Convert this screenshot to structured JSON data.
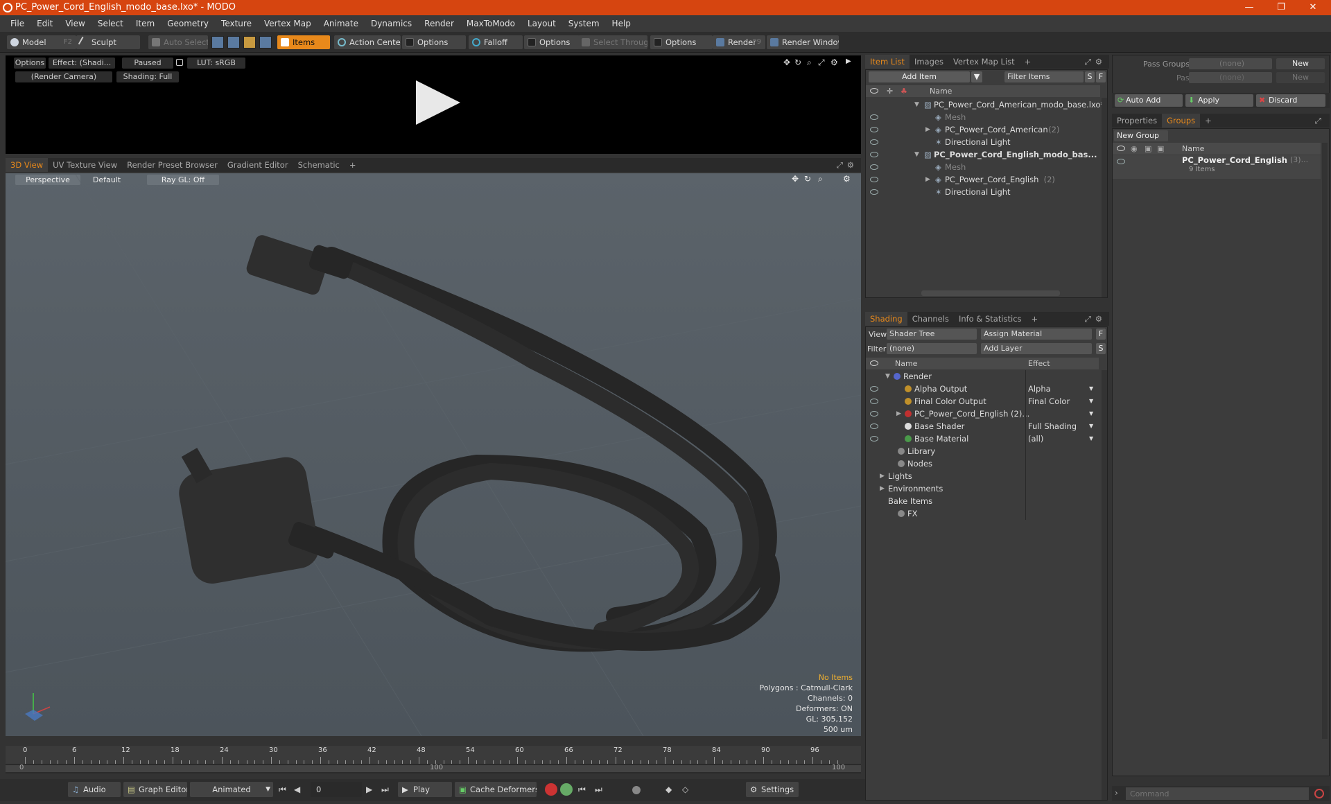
{
  "window": {
    "title": "PC_Power_Cord_English_modo_base.lxo* - MODO",
    "minimize": "—",
    "restore": "❐",
    "close": "✕"
  },
  "menu": [
    "File",
    "Edit",
    "View",
    "Select",
    "Item",
    "Geometry",
    "Texture",
    "Vertex Map",
    "Animate",
    "Dynamics",
    "Render",
    "MaxToModo",
    "Layout",
    "System",
    "Help"
  ],
  "toolbar": {
    "model": "Model",
    "model_key": "F2",
    "sculpt": "Sculpt",
    "auto_select": "Auto Select",
    "items": "Items",
    "action_center": "Action Center",
    "options1": "Options",
    "falloff": "Falloff",
    "options2": "Options",
    "select_through": "Select Through",
    "options3": "Options",
    "render": "Render",
    "render_key": "F9",
    "render_window": "Render Window"
  },
  "preview": {
    "options": "Options",
    "effect": "Effect: (Shadi...",
    "paused": "Paused",
    "lut": "LUT: sRGB",
    "camera": "(Render Camera)",
    "shading": "Shading: Full"
  },
  "viewport_tabs": [
    "3D View",
    "UV Texture View",
    "Render Preset Browser",
    "Gradient Editor",
    "Schematic",
    "+"
  ],
  "viewport": {
    "perspective": "Perspective",
    "default": "Default",
    "raygl": "Ray GL: Off"
  },
  "stats": {
    "no_items": "No Items",
    "polygons": "Polygons : Catmull-Clark",
    "channels": "Channels: 0",
    "deformers": "Deformers: ON",
    "gl": "GL: 305,152",
    "scale": "500 um"
  },
  "timeline": {
    "ticks": [
      "0",
      "6",
      "12",
      "18",
      "24",
      "30",
      "36",
      "42",
      "48",
      "54",
      "60",
      "66",
      "72",
      "78",
      "84",
      "90",
      "96"
    ],
    "range_start": "0",
    "range_mid": "100",
    "range_end": "100"
  },
  "bottom": {
    "audio": "Audio",
    "graph_editor": "Graph Editor",
    "animated": "Animated",
    "frame": "0",
    "play": "Play",
    "cache_deformers": "Cache Deformers",
    "settings": "Settings"
  },
  "item_list": {
    "tabs": [
      "Item List",
      "Images",
      "Vertex Map List",
      "+"
    ],
    "add_item": "Add Item",
    "filter_items": "Filter Items",
    "s": "S",
    "f": "F",
    "col_name": "Name",
    "rows": [
      {
        "label": "PC_Power_Cord_American_modo_base.lxo*",
        "count": ""
      },
      {
        "label": "Mesh",
        "count": ""
      },
      {
        "label": "PC_Power_Cord_American",
        "count": "(2)"
      },
      {
        "label": "Directional Light",
        "count": ""
      },
      {
        "label": "PC_Power_Cord_English_modo_bas...",
        "count": ""
      },
      {
        "label": "Mesh",
        "count": ""
      },
      {
        "label": "PC_Power_Cord_English",
        "count": "(2)"
      },
      {
        "label": "Directional Light",
        "count": ""
      }
    ]
  },
  "shading": {
    "tabs": [
      "Shading",
      "Channels",
      "Info & Statistics",
      "+"
    ],
    "view_label": "View",
    "view_value": "Shader Tree",
    "assign_material": "Assign Material",
    "filter_label": "Filter",
    "filter_value": "(none)",
    "add_layer": "Add Layer",
    "f": "F",
    "s": "S",
    "col_name": "Name",
    "col_effect": "Effect",
    "rows": [
      {
        "label": "Render",
        "effect": ""
      },
      {
        "label": "Alpha Output",
        "effect": "Alpha"
      },
      {
        "label": "Final Color Output",
        "effect": "Final Color"
      },
      {
        "label": "PC_Power_Cord_English (2)...",
        "effect": ""
      },
      {
        "label": "Base Shader",
        "effect": "Full Shading"
      },
      {
        "label": "Base Material",
        "effect": "(all)"
      },
      {
        "label": "Library",
        "effect": ""
      },
      {
        "label": "Nodes",
        "effect": ""
      },
      {
        "label": "Lights",
        "effect": ""
      },
      {
        "label": "Environments",
        "effect": ""
      },
      {
        "label": "Bake Items",
        "effect": ""
      },
      {
        "label": "FX",
        "effect": ""
      }
    ]
  },
  "passes": {
    "pass_groups": "Pass Groups",
    "passes": "Passes",
    "none": "(none)",
    "new": "New"
  },
  "groups_actions": {
    "auto_add": "Auto Add",
    "apply": "Apply",
    "discard": "Discard"
  },
  "groups": {
    "tabs": [
      "Properties",
      "Groups",
      "+"
    ],
    "new_group": "New Group",
    "col_name": "Name",
    "item_name": "PC_Power_Cord_English",
    "item_count": "(3)...",
    "item_sub": "9 Items"
  },
  "command": {
    "placeholder": "Command"
  }
}
